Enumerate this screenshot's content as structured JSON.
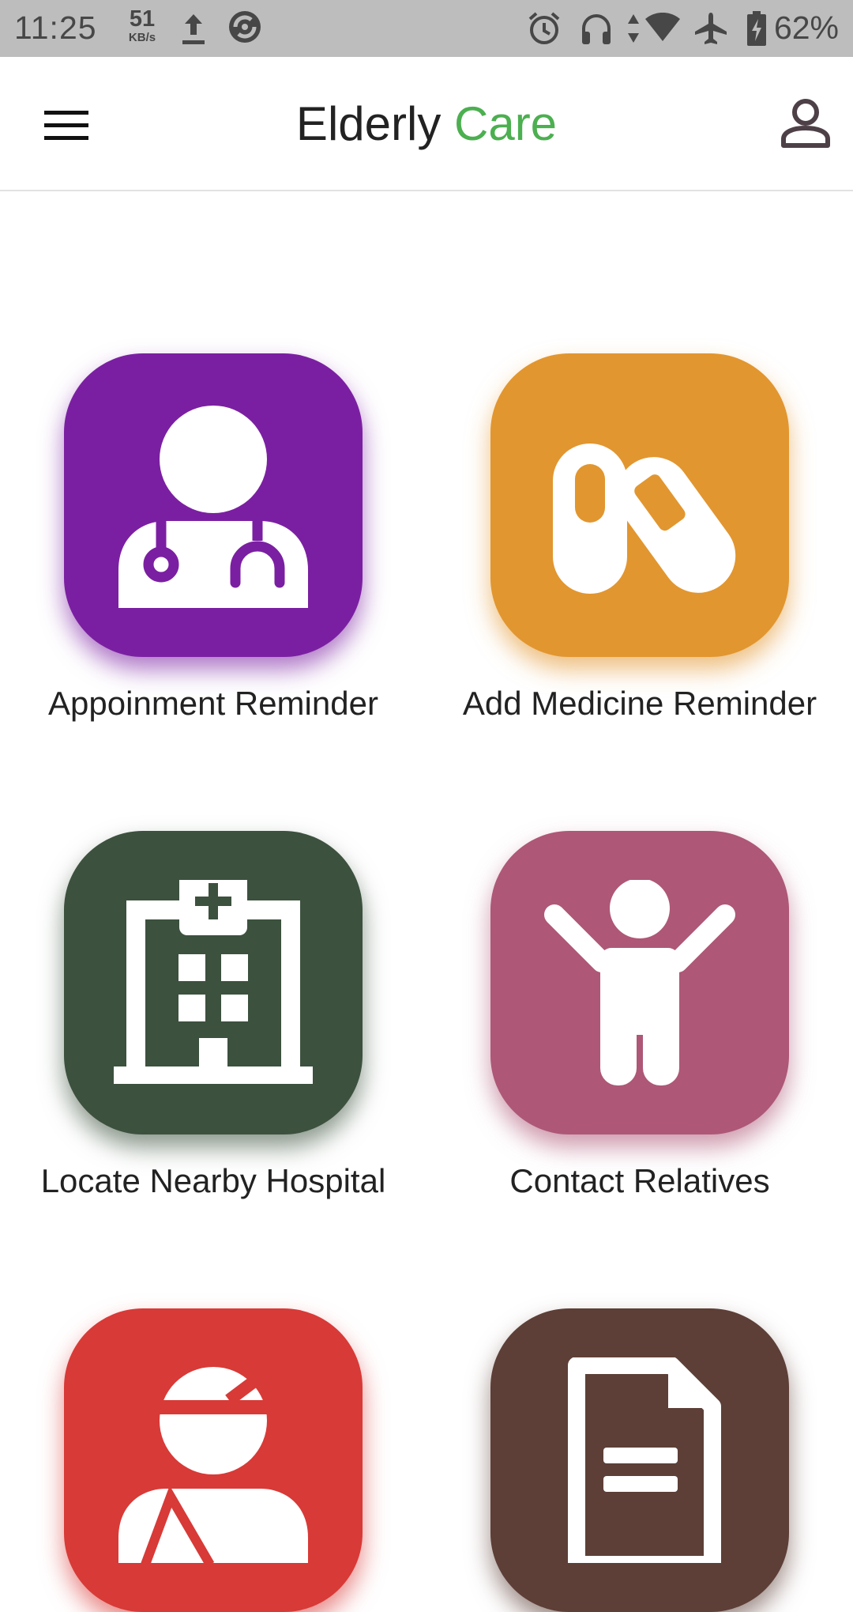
{
  "status_bar": {
    "time": "11:25",
    "net_speed_value": "51",
    "net_speed_unit": "KB/s",
    "battery_percent": "62%",
    "icons": [
      "upload-icon",
      "sync-icon",
      "alarm-icon",
      "headset-icon",
      "data-arrows-icon",
      "wifi-icon",
      "airplane-icon",
      "battery-charging-icon"
    ]
  },
  "app_bar": {
    "title_part1": "Elderly",
    "title_part2": "Care",
    "accent_color": "#4caf50",
    "menu_icon": "hamburger-menu-icon",
    "profile_icon": "profile-icon"
  },
  "tiles": [
    {
      "label": "Appoinment Reminder",
      "icon": "doctor-icon",
      "color": "#7b1fa2"
    },
    {
      "label": "Add Medicine Reminder",
      "icon": "pills-icon",
      "color": "#e2962f"
    },
    {
      "label": "Locate Nearby Hospital",
      "icon": "hospital-icon",
      "color": "#3c513e"
    },
    {
      "label": "Contact Relatives",
      "icon": "person-arms-up-icon",
      "color": "#ae5776"
    },
    {
      "label": "",
      "icon": "injured-person-icon",
      "color": "#d83a37"
    },
    {
      "label": "",
      "icon": "document-icon",
      "color": "#5d3f37"
    }
  ]
}
